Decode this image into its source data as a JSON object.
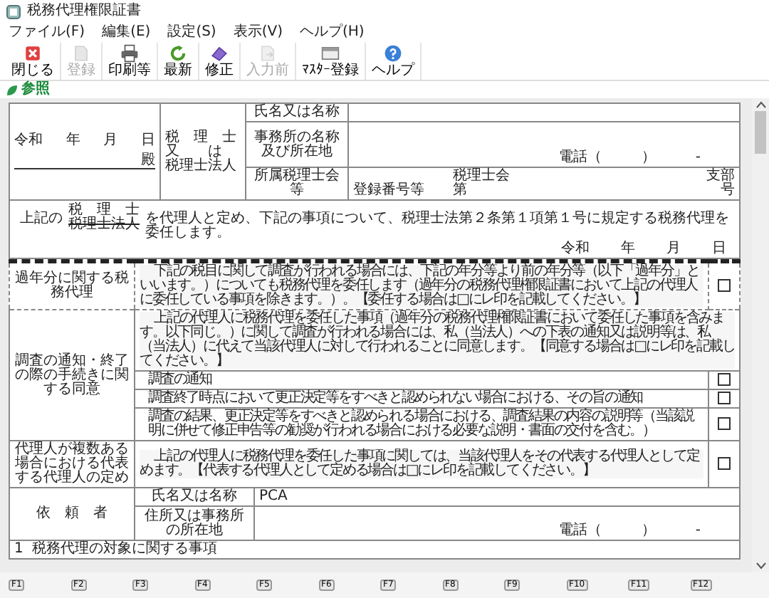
{
  "window": {
    "title": "税務代理権限証書"
  },
  "menu": [
    "ファイル(F)",
    "編集(E)",
    "設定(S)",
    "表示(V)",
    "ヘルプ(H)"
  ],
  "toolbar": [
    {
      "label": "閉じる",
      "kind": "close",
      "disabled": false
    },
    {
      "label": "登録",
      "kind": "save",
      "disabled": true
    },
    {
      "label": "印刷等",
      "kind": "print",
      "disabled": false
    },
    {
      "label": "最新",
      "kind": "refresh",
      "disabled": false
    },
    {
      "label": "修正",
      "kind": "edit",
      "disabled": false
    },
    {
      "label": "入力前",
      "kind": "undo",
      "disabled": true
    },
    {
      "label": "ﾏｽﾀｰ登録",
      "kind": "master",
      "disabled": false
    },
    {
      "label": "ヘルプ",
      "kind": "help",
      "disabled": false
    }
  ],
  "tab": {
    "label": "参照"
  },
  "agent": {
    "date": [
      "令和",
      "年",
      "月",
      "日"
    ],
    "honorific": "殿",
    "type": [
      "税　理　士",
      "又　　は",
      "税理士法人"
    ],
    "name_label": "氏名又は名称",
    "office_label": "事務所の名称及び所在地",
    "phone": [
      "電話（",
      "）",
      "-"
    ],
    "assoc_label": "所属税理士会等",
    "reg_label": "登録番号等",
    "assoc": "税理士会",
    "branch": "支部",
    "no_prefix": "第",
    "no_suffix": "号"
  },
  "appointment": {
    "prefix": "上記の",
    "options": [
      {
        "text": "税　理　士",
        "struck": false
      },
      {
        "text": "税理士法人",
        "struck": true
      }
    ],
    "text": "を代理人と定め、下記の事項について、税理士法第２条第１項第１号に規定する税務代理を委任します。",
    "date": [
      "令和",
      "年",
      "月",
      "日"
    ]
  },
  "sections": [
    {
      "heading": "過年分に関する税務代理",
      "text": "下記の税目に関して調査が行われる場合には、下記の年分等より前の年分等（以下「過年分」といいます。）についても税務代理を委任します（過年分の税務代理権限証書において上記の代理人に委任している事項を除きます。）。【委任する場合は□にレ印を記載してください。】",
      "checked": false
    },
    {
      "heading": "調査の通知・終了の際の手続きに関する同意",
      "text": "上記の代理人に税務代理を委任した事項（過年分の税務代理権限証書において委任した事項を含みます。以下同じ。）に関して調査が行われる場合には、私（当法人）への下表の通知又は説明等は、私（当法人）に代えて当該代理人に対して行われることに同意します。【同意する場合は□にレ印を記載してください。】",
      "items": [
        {
          "text": "調査の通知",
          "checked": false
        },
        {
          "text": "調査終了時点において更正決定等をすべきと認められない場合における、その旨の通知",
          "checked": false
        },
        {
          "text": "調査の結果、更正決定等をすべきと認められる場合における、調査結果の内容の説明等（当該説明に併せて修正申告等の勧奨が行われる場合における必要な説明・書面の交付を含む。）",
          "checked": false
        }
      ]
    },
    {
      "heading": "代理人が複数ある場合における代表する代理人の定め",
      "text": "上記の代理人に税務代理を委任した事項に関しては、当該代理人をその代表する代理人として定めます。【代表する代理人として定める場合は□にレ印を記載してください。】",
      "checked": false
    }
  ],
  "client": {
    "heading": "依　頼　者",
    "name_label": "氏名又は名称",
    "name": "PCA",
    "address_label": "住所又は事務所の所在地",
    "phone": [
      "電話（",
      "）",
      "-"
    ]
  },
  "footer_row": "1  税務代理の対象に関する事項",
  "function_keys": [
    "F1",
    "F2",
    "F3",
    "F4",
    "F5",
    "F6",
    "F7",
    "F8",
    "F9",
    "F10",
    "F11",
    "F12"
  ]
}
